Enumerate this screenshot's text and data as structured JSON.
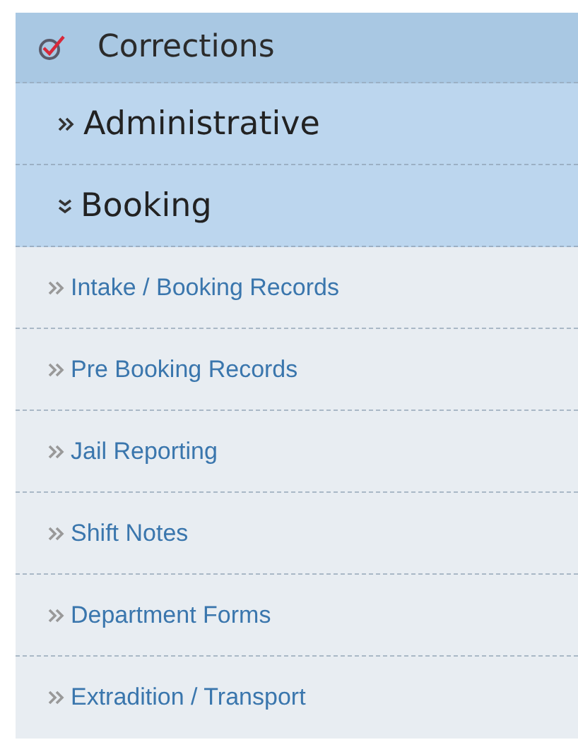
{
  "menu": {
    "title": "Corrections",
    "sections": [
      {
        "label": "Administrative",
        "expanded": false
      },
      {
        "label": "Booking",
        "expanded": true,
        "children": [
          {
            "label": "Intake / Booking Records"
          },
          {
            "label": "Pre Booking Records"
          },
          {
            "label": "Jail Reporting"
          },
          {
            "label": "Shift Notes"
          },
          {
            "label": "Department Forms"
          },
          {
            "label": "Extradition / Transport"
          }
        ]
      }
    ]
  }
}
